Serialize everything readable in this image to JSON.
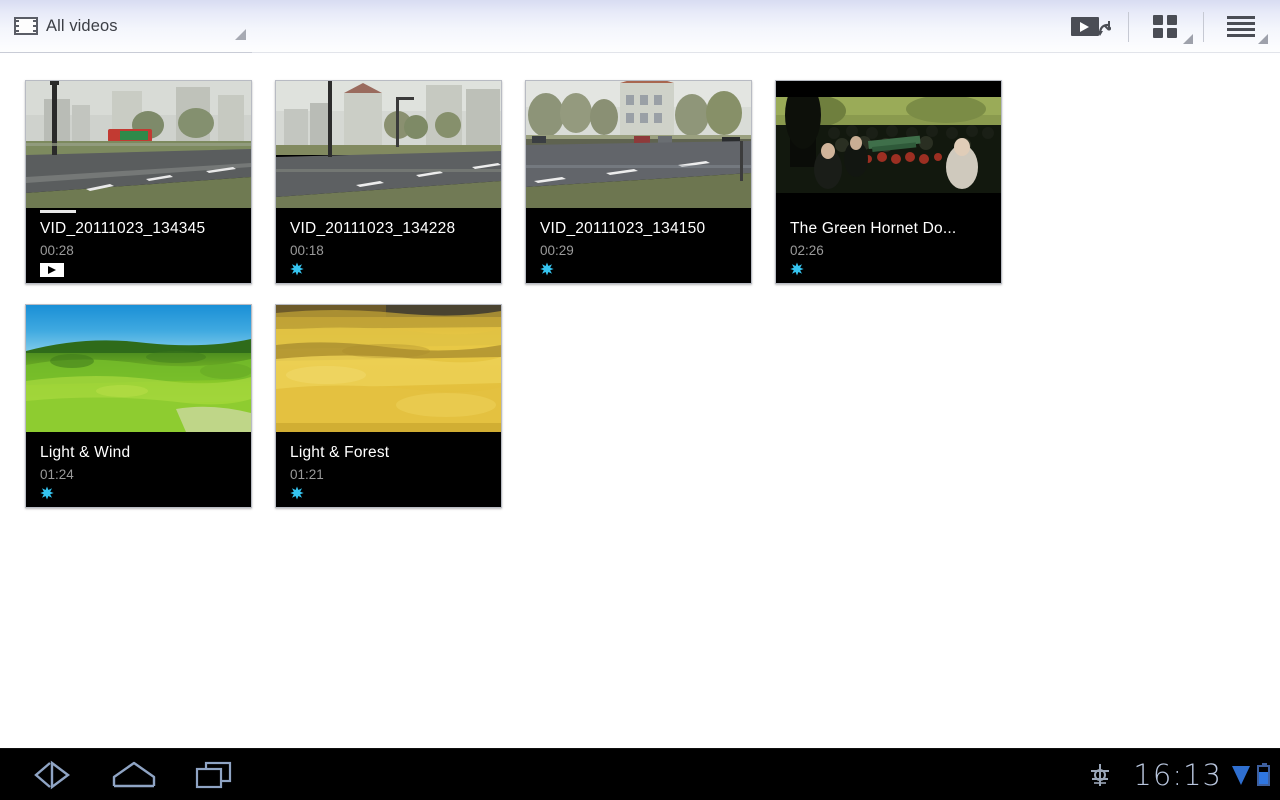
{
  "header": {
    "tab": {
      "label": "All videos",
      "icon": "film-strip-icon",
      "caret": "dropdown-caret"
    },
    "actions": [
      {
        "name": "video-refresh-button",
        "icon": "video-refresh-icon",
        "has_caret": false
      },
      {
        "name": "grid-view-button",
        "icon": "grid-view-icon",
        "has_caret": true
      },
      {
        "name": "list-view-button",
        "icon": "list-view-icon",
        "has_caret": true
      }
    ]
  },
  "videos": [
    {
      "title": "VID_20111023_134345",
      "duration": "00:28",
      "badge": "play-badge",
      "has_progress": true,
      "scene": "street-buildings-overcast"
    },
    {
      "title": "VID_20111023_134228",
      "duration": "00:18",
      "badge": "star-badge",
      "has_progress": false,
      "scene": "street-buildings-overcast"
    },
    {
      "title": "VID_20111023_134150",
      "duration": "00:29",
      "badge": "star-badge",
      "has_progress": false,
      "scene": "street-trees-overcast"
    },
    {
      "title": "The Green Hornet Do...",
      "duration": "02:26",
      "badge": "star-badge",
      "has_progress": false,
      "scene": "movie-crowd-letterbox"
    },
    {
      "title": "Light & Wind",
      "duration": "01:24",
      "badge": "star-badge",
      "has_progress": false,
      "scene": "green-hills-blue-sky"
    },
    {
      "title": "Light & Forest",
      "duration": "01:21",
      "badge": "star-badge",
      "has_progress": false,
      "scene": "golden-wheat-field"
    }
  ],
  "system_bar": {
    "back": "back-icon",
    "home": "home-icon",
    "recents": "recent-apps-icon",
    "usb": "usb-debug-icon",
    "clock": "16:13",
    "signal": "signal-icon",
    "battery": "battery-icon"
  },
  "colors": {
    "accent_badge": "#35c4f0",
    "card_bg": "#000000",
    "title_text": "#ffffff",
    "duration_text": "#9a9a9a",
    "header_gradient_top": "#d8dcf2",
    "status_blue": "#2f76e0"
  }
}
